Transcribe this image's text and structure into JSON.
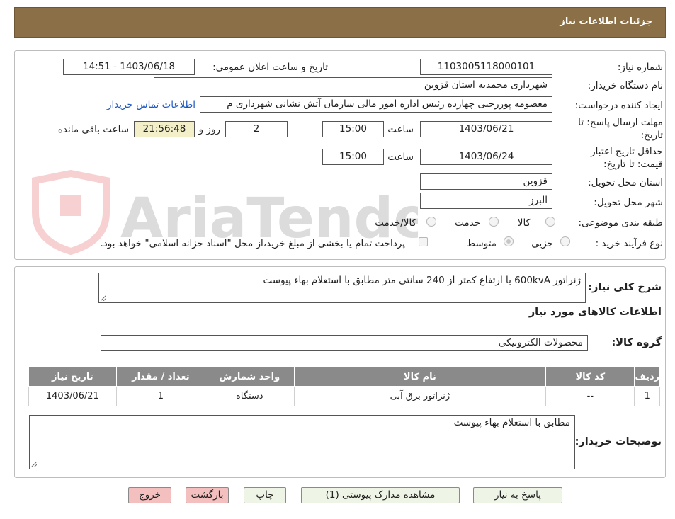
{
  "header": {
    "title": "جزئیات اطلاعات نیاز"
  },
  "watermark": {
    "text": "AriaTender.neT"
  },
  "form": {
    "need_number": {
      "label": "شماره نیاز:",
      "value": "1103005118000101"
    },
    "announce": {
      "label": "تاریخ و ساعت اعلان عمومی:",
      "value": "1403/06/18 - 14:51"
    },
    "buyer_org": {
      "label": "نام دستگاه خریدار:",
      "value": "شهرداری محمدیه استان قزوین"
    },
    "creator": {
      "label": "ایجاد کننده درخواست:",
      "value": "معصومه پوررجبی چهارده رئیس اداره امور مالی سازمان آتش نشانی شهرداری م",
      "contact_link": "اطلاعات تماس خریدار"
    },
    "deadline": {
      "label_line1": "مهلت ارسال پاسخ: تا",
      "label_line2": "تاریخ:",
      "date": "1403/06/21",
      "time_label": "ساعت",
      "time": "15:00",
      "days": "2",
      "days_label": "روز و",
      "remaining": "21:56:48",
      "remaining_label": "ساعت باقی مانده"
    },
    "price_validity": {
      "label_line1": "حداقل تاریخ اعتبار",
      "label_line2": "قیمت: تا تاریخ:",
      "date": "1403/06/24",
      "time_label": "ساعت",
      "time": "15:00"
    },
    "province": {
      "label": "استان محل تحویل:",
      "value": "قزوین"
    },
    "city": {
      "label": "شهر محل تحویل:",
      "value": "البرز"
    },
    "category": {
      "label": "طبقه بندی موضوعی:",
      "options": [
        "کالا",
        "خدمت",
        "کالا/خدمت"
      ],
      "selected": "کالا"
    },
    "process": {
      "label": "نوع فرآیند خرید :",
      "options": [
        "جزیی",
        "متوسط"
      ],
      "selected": "متوسط",
      "payment_note": "پرداخت تمام یا بخشی از مبلغ خرید،از محل \"اسناد خزانه اسلامی\" خواهد بود."
    }
  },
  "summary": {
    "label": "شرح کلی نیاز:",
    "value": "ژنراتور 600kvA با ارتفاع کمتر از 240 سانتی متر مطابق با استعلام بهاء پیوست"
  },
  "goods_section": {
    "title": "اطلاعات کالاهای مورد نیاز"
  },
  "goods_group": {
    "label": "گروه کالا:",
    "value": "محصولات الکترونیکی"
  },
  "table": {
    "headers": [
      "ردیف",
      "کد کالا",
      "نام کالا",
      "واحد شمارش",
      "تعداد / مقدار",
      "تاریخ نیاز"
    ],
    "rows": [
      [
        "1",
        "--",
        "ژنراتور برق آبی",
        "دستگاه",
        "1",
        "1403/06/21"
      ]
    ]
  },
  "buyer_notes": {
    "label": "توضیحات خریدار:",
    "value": "مطابق با استعلام بهاء پیوست"
  },
  "buttons": {
    "reply": "پاسخ به نیاز",
    "attachments": "مشاهده مدارک پیوستی (1)",
    "print": "چاپ",
    "back": "بازگشت",
    "exit": "خروج"
  },
  "colors": {
    "header_bg": "#8b6f47",
    "table_header_bg": "#8a8a8a",
    "button_bg": "#eef4e6",
    "button_red_bg": "#f4c0bf",
    "countdown_bg": "#f3efc8",
    "link": "#1a56c4"
  }
}
